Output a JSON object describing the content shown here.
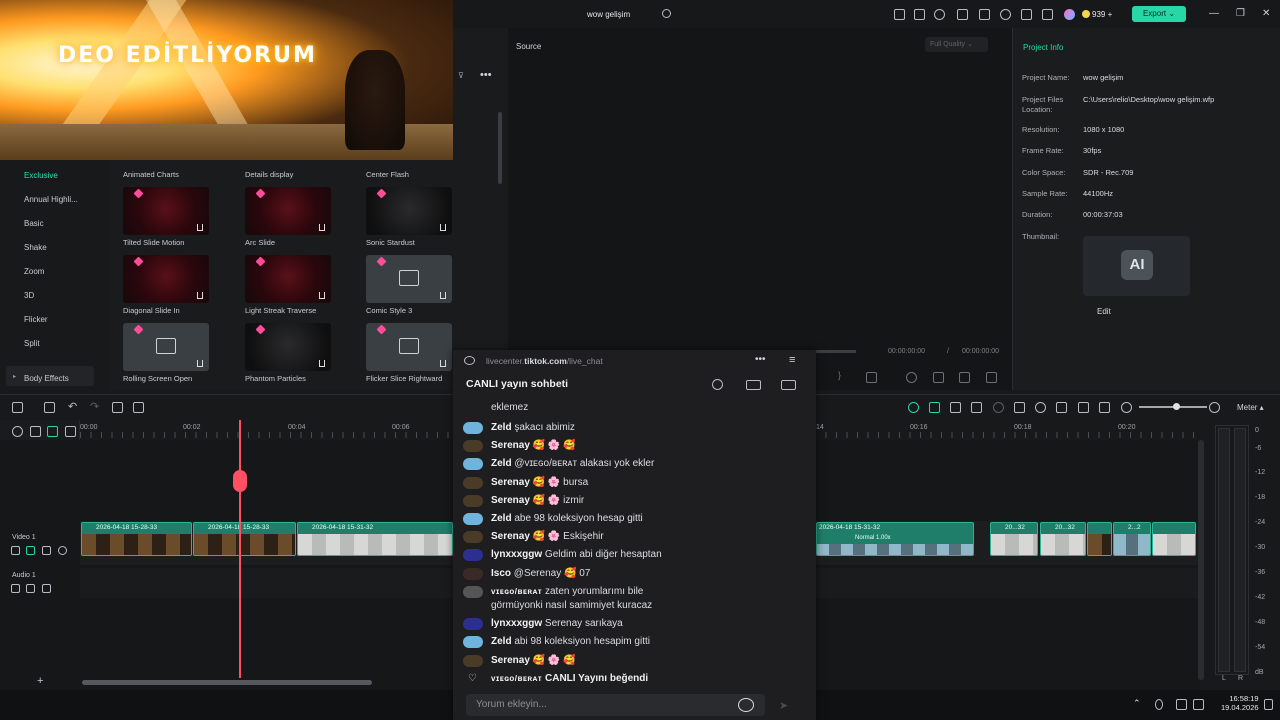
{
  "titlebar": {
    "project": "wow gelişim",
    "export": "Export",
    "credits": "939"
  },
  "preview": {
    "overlay_text": "DEO EDİTLİYORUM"
  },
  "library": {
    "categories": [
      "Exclusive",
      "Annual Highli...",
      "Basic",
      "Shake",
      "Zoom",
      "3D",
      "Flicker",
      "Split",
      "Body Effects"
    ],
    "top_labels": [
      "Animated Charts",
      "Details display",
      "Center Flash"
    ],
    "tiles": [
      {
        "label": "Tilted Slide Motion"
      },
      {
        "label": "Arc Slide"
      },
      {
        "label": "Sonic Stardust"
      },
      {
        "label": "Diagonal Slide In"
      },
      {
        "label": "Light Streak Traverse"
      },
      {
        "label": "Comic Style 3"
      },
      {
        "label": "Rolling Screen Open"
      },
      {
        "label": "Phantom Particles"
      },
      {
        "label": "Flicker Slice Rightward"
      }
    ]
  },
  "source": {
    "label": "Source",
    "quality": "Full Quality",
    "time_current": "00:00:00:00",
    "time_sep": "/",
    "time_total": "00:00:00:00"
  },
  "project_info": {
    "title": "Project Info",
    "rows": [
      {
        "k": "Project Name:",
        "v": "wow gelişim"
      },
      {
        "k": "Project Files Location:",
        "v": "C:\\Users\\relio\\Desktop\\wow gelişim.wfp"
      },
      {
        "k": "Resolution:",
        "v": "1080 x 1080"
      },
      {
        "k": "Frame Rate:",
        "v": "30fps"
      },
      {
        "k": "Color Space:",
        "v": "SDR - Rec.709"
      },
      {
        "k": "Sample Rate:",
        "v": "44100Hz"
      },
      {
        "k": "Duration:",
        "v": "00:00:37:03"
      },
      {
        "k": "Thumbnail:",
        "v": ""
      }
    ],
    "thumb_text": "AI",
    "edit": "Edit"
  },
  "timeline": {
    "ticks": [
      "00:00",
      "00:02",
      "00:04",
      "00:06",
      "14",
      "00:16",
      "00:18",
      "00:20"
    ],
    "video_track": "Video 1",
    "audio_track": "Audio 1",
    "clips": [
      "2026-04-18 15-28-33",
      "2026-04-18 15-28-33",
      "2026-04-18 15-31-32",
      "2026-04-18 15-31-32",
      "20...32",
      "20...32",
      "2...2"
    ],
    "speed_label": "Normal 1.00x",
    "meter_label": "Meter",
    "meter_scale": [
      "0",
      "-6",
      "-12",
      "-18",
      "-24",
      "-30",
      "-36",
      "-42",
      "-48",
      "-54",
      "dB"
    ],
    "lr": [
      "L",
      "R"
    ]
  },
  "chat": {
    "url_prefix": "livecenter.",
    "url_bold": "tiktok.com",
    "url_suffix": "/live_chat",
    "title": "CANLI yayın sohbeti",
    "messages": [
      {
        "u": "",
        "t": "eklemez",
        "av": "vb"
      },
      {
        "u": "Zeld",
        "t": "şakacı abimiz",
        "av": ""
      },
      {
        "u": "Serenay",
        "t": "🥰 🌸 🥰",
        "av": "sr"
      },
      {
        "u": "Zeld",
        "t": "@ᴠɪᴇɢᴏ/ʙᴇʀᴀᴛ alakası yok ekler",
        "av": ""
      },
      {
        "u": "Serenay",
        "t": "🥰 🌸 bursa",
        "av": "sr"
      },
      {
        "u": "Serenay",
        "t": "🥰 🌸 izmir",
        "av": "sr"
      },
      {
        "u": "Zeld",
        "t": "abe 98 koleksiyon hesap gitti",
        "av": ""
      },
      {
        "u": "Serenay",
        "t": "🥰 🌸 Eskişehir",
        "av": "sr"
      },
      {
        "u": "lynxxxggw",
        "t": "Geldim abi diğer hesaptan",
        "av": "ly"
      },
      {
        "u": "Isco",
        "t": "@Serenay 🥰 07",
        "av": "is"
      },
      {
        "u": "ᴠɪᴇɢᴏ/ʙᴇʀᴀᴛ",
        "t": "zaten yorumlarımı bile",
        "t2": "görmüyonki nasıl samimiyet kuracaz",
        "av": "vb"
      },
      {
        "u": "lynxxxggw",
        "t": "Serenay sarıkaya",
        "av": "ly"
      },
      {
        "u": "Zeld",
        "t": "abi 98 koleksiyon hesapim gitti",
        "av": ""
      },
      {
        "u": "Serenay",
        "t": "🥰 🌸 🥰",
        "av": "sr"
      },
      {
        "u": "ᴠɪᴇɢᴏ/ʙᴇʀᴀᴛ",
        "t": "CANLI Yayını beğendi",
        "av": "like"
      }
    ],
    "input_placeholder": "Yorum ekleyin..."
  },
  "taskbar": {
    "time": "16:58:19",
    "date": "19.04.2026"
  }
}
